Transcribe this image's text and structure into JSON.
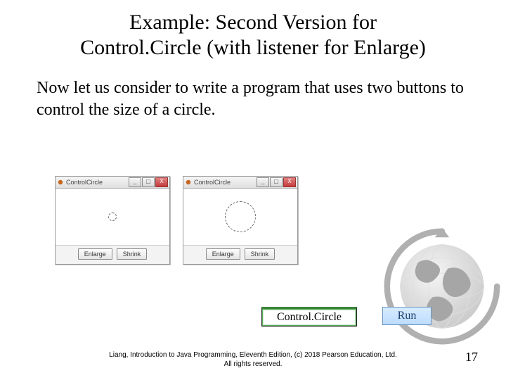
{
  "title_line1": "Example: Second Version for",
  "title_line2": "Control.Circle (with listener for Enlarge)",
  "body": "Now let us consider to write a program that uses two buttons to control the size of a circle.",
  "windows": {
    "title": "ControlCircle",
    "enlarge": "Enlarge",
    "shrink": "Shrink",
    "min": "_",
    "max": "▢",
    "close": "X"
  },
  "links": {
    "controlcircle": "Control.Circle",
    "run": "Run"
  },
  "footer_line1": "Liang, Introduction to Java Programming, Eleventh Edition, (c) 2018 Pearson Education, Ltd.",
  "footer_line2": "All rights reserved.",
  "pagenum": "17"
}
